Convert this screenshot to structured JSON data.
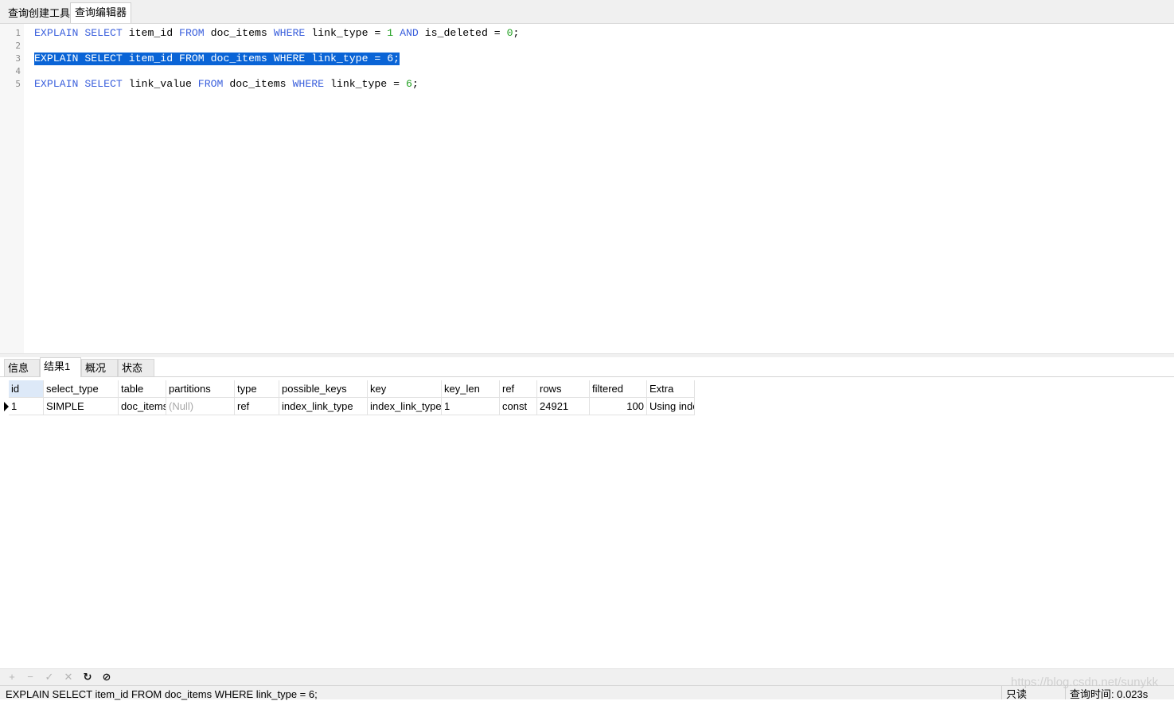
{
  "top_tabs": [
    {
      "label": "查询创建工具",
      "active": false
    },
    {
      "label": "查询编辑器",
      "active": true
    }
  ],
  "editor": {
    "lines": [
      {
        "num": "1",
        "tokens": [
          [
            "kw",
            "EXPLAIN"
          ],
          [
            "id",
            " "
          ],
          [
            "kw",
            "SELECT"
          ],
          [
            "id",
            " item_id "
          ],
          [
            "kw",
            "FROM"
          ],
          [
            "id",
            " doc_items "
          ],
          [
            "kw",
            "WHERE"
          ],
          [
            "id",
            " link_type = "
          ],
          [
            "num",
            "1"
          ],
          [
            "id",
            " "
          ],
          [
            "kw",
            "AND"
          ],
          [
            "id",
            " is_deleted = "
          ],
          [
            "num",
            "0"
          ],
          [
            "id",
            ";"
          ]
        ],
        "selected": false
      },
      {
        "num": "2",
        "tokens": [],
        "selected": false
      },
      {
        "num": "3",
        "tokens": [
          [
            "kw",
            "EXPLAIN"
          ],
          [
            "id",
            " "
          ],
          [
            "kw",
            "SELECT"
          ],
          [
            "id",
            " item_id "
          ],
          [
            "kw",
            "FROM"
          ],
          [
            "id",
            " doc_items "
          ],
          [
            "kw",
            "WHERE"
          ],
          [
            "id",
            " link_type = "
          ],
          [
            "num",
            "6"
          ],
          [
            "id",
            ";"
          ]
        ],
        "selected": true
      },
      {
        "num": "4",
        "tokens": [],
        "selected": false
      },
      {
        "num": "5",
        "tokens": [
          [
            "kw",
            "EXPLAIN"
          ],
          [
            "id",
            " "
          ],
          [
            "kw",
            "SELECT"
          ],
          [
            "id",
            " link_value "
          ],
          [
            "kw",
            "FROM"
          ],
          [
            "id",
            " doc_items "
          ],
          [
            "kw",
            "WHERE"
          ],
          [
            "id",
            " link_type = "
          ],
          [
            "num",
            "6"
          ],
          [
            "id",
            ";"
          ]
        ],
        "selected": false
      }
    ]
  },
  "result_tabs": [
    {
      "label": "信息",
      "active": false
    },
    {
      "label": "结果1",
      "active": true
    },
    {
      "label": "概况",
      "active": false
    },
    {
      "label": "状态",
      "active": false
    }
  ],
  "grid": {
    "columns": [
      "id",
      "select_type",
      "table",
      "partitions",
      "type",
      "possible_keys",
      "key",
      "key_len",
      "ref",
      "rows",
      "filtered",
      "Extra"
    ],
    "rows": [
      [
        "1",
        "SIMPLE",
        "doc_items",
        "(Null)",
        "ref",
        "index_link_type",
        "index_link_type",
        "1",
        "const",
        "24921",
        "100",
        "Using index"
      ]
    ]
  },
  "toolbar": {
    "icons": [
      {
        "name": "add-record-icon",
        "glyph": "+",
        "enabled": false
      },
      {
        "name": "delete-record-icon",
        "glyph": "−",
        "enabled": false
      },
      {
        "name": "apply-icon",
        "glyph": "✓",
        "enabled": false
      },
      {
        "name": "discard-icon",
        "glyph": "✕",
        "enabled": false
      },
      {
        "name": "refresh-icon",
        "glyph": "↻",
        "enabled": true
      },
      {
        "name": "stop-icon",
        "glyph": "⊘",
        "enabled": true
      }
    ]
  },
  "statusbar": {
    "sql": "EXPLAIN SELECT item_id FROM doc_items WHERE link_type = 6;",
    "mode": "只读",
    "query_time": "查询时间: 0.023s"
  },
  "watermark": "https://blog.csdn.net/sunykk",
  "colors": {
    "keyword": "#3a5fdc",
    "number": "#22a022",
    "selection": "#0a64d6"
  }
}
